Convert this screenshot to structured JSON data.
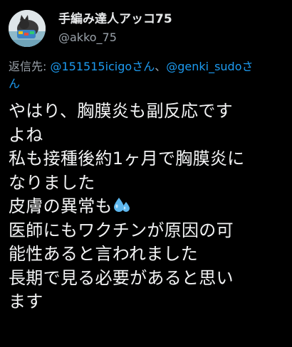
{
  "tweet": {
    "author": {
      "display_name": "手編み達人アッコ75",
      "handle": "@akko_75",
      "avatar_icon": "cat-avatar-icon"
    },
    "reply": {
      "prefix": "返信先: ",
      "mention1": "@151515icigoさん",
      "separator": "、",
      "mention2": "@genki_sudoさ",
      "mention2_wrap": "ん"
    },
    "body_lines": [
      "やはり、胸膜炎も副反応です",
      "よね",
      "私も接種後約1ヶ月で胸膜炎に",
      "なりました",
      "皮膚の異常も",
      "医師にもワクチンが原因の可",
      "能性あると言われました",
      "長期で見る必要があると思い",
      "ます"
    ],
    "emoji": "sweat-droplets-icon"
  },
  "colors": {
    "background": "#000000",
    "text": "#e7e9ea",
    "secondary": "#9aa2aa",
    "accent": "#1d9bf0"
  }
}
